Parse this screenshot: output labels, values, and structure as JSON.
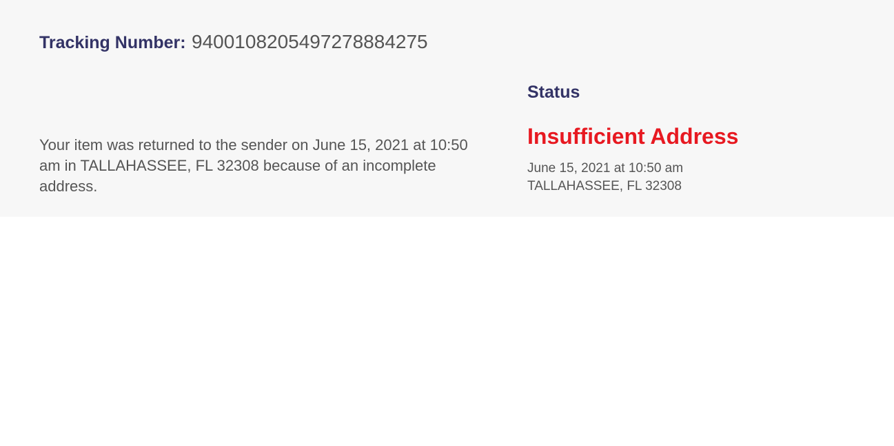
{
  "tracking": {
    "label": "Tracking Number:",
    "number": "9400108205497278884275"
  },
  "description": "Your item was returned to the sender on June 15, 2021 at 10:50 am in TALLAHASSEE, FL 32308 because of an incomplete address.",
  "status": {
    "heading": "Status",
    "title": "Insufficient Address",
    "date": "June 15, 2021 at 10:50 am",
    "location": "TALLAHASSEE, FL 32308"
  },
  "colors": {
    "navy": "#333366",
    "alert_red": "#e71921",
    "text_gray": "#555555",
    "panel_bg": "#f7f7f7"
  }
}
